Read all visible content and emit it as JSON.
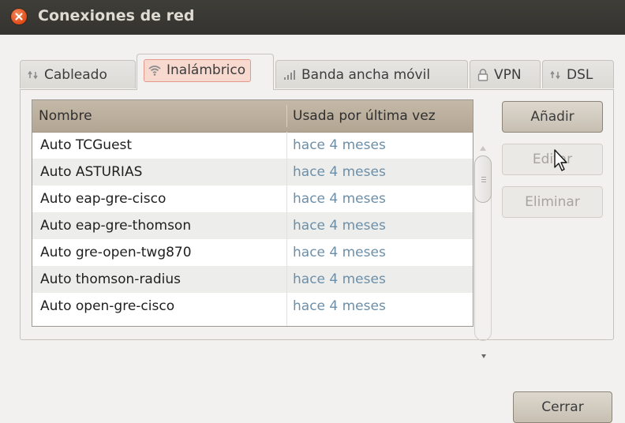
{
  "window": {
    "title": "Conexiones de red"
  },
  "tabs": [
    {
      "label": "Cableado",
      "icon": "wired-network-icon"
    },
    {
      "label": "Inalámbrico",
      "icon": "wireless-icon",
      "active": true
    },
    {
      "label": "Banda ancha móvil",
      "icon": "mobile-broadband-icon"
    },
    {
      "label": "VPN",
      "icon": "vpn-lock-icon"
    },
    {
      "label": "DSL",
      "icon": "dsl-network-icon"
    }
  ],
  "table": {
    "headers": {
      "name": "Nombre",
      "last_used": "Usada por última vez"
    },
    "rows": [
      {
        "name": "Auto TCGuest",
        "last_used": "hace 4 meses"
      },
      {
        "name": "Auto ASTURIAS",
        "last_used": "hace 4 meses"
      },
      {
        "name": "Auto eap-gre-cisco",
        "last_used": "hace 4 meses"
      },
      {
        "name": "Auto eap-gre-thomson",
        "last_used": "hace 4 meses"
      },
      {
        "name": "Auto gre-open-twg870",
        "last_used": "hace 4 meses"
      },
      {
        "name": "Auto thomson-radius",
        "last_used": "hace 4 meses"
      },
      {
        "name": "Auto open-gre-cisco",
        "last_used": "hace 4 meses"
      }
    ]
  },
  "buttons": {
    "add": "Añadir",
    "edit": "Editar",
    "delete": "Eliminar",
    "close": "Cerrar"
  },
  "colors": {
    "titlebar": "#3c3b37",
    "close_button": "#df4a16",
    "active_tab_highlight": "#f7d9cf",
    "header": "#bdb1a0",
    "last_used_text": "#6c8fa9"
  }
}
